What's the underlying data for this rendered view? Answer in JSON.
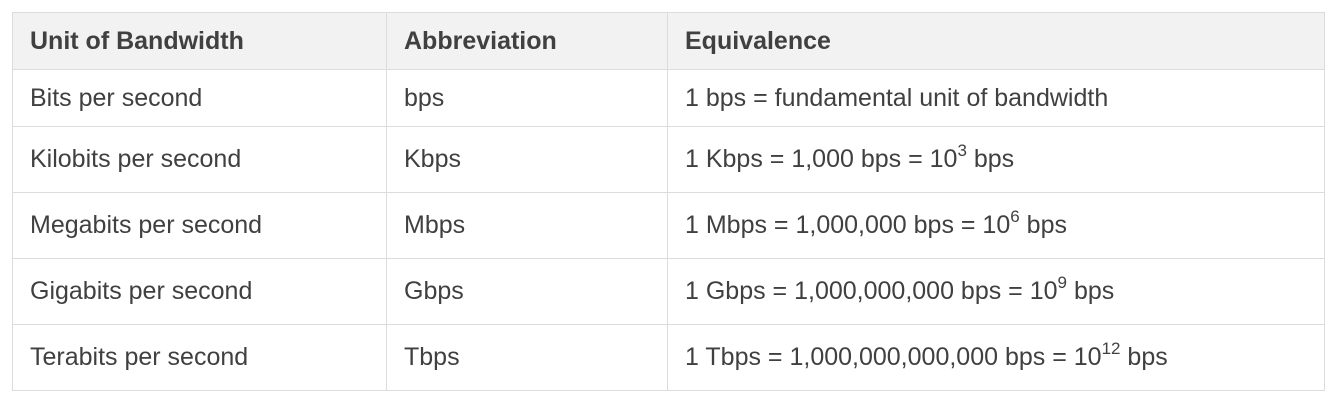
{
  "table": {
    "headers": [
      "Unit of Bandwidth",
      "Abbreviation",
      "Equivalence"
    ],
    "rows": [
      {
        "unit": "Bits per second",
        "abbr": "bps",
        "eq_main": "1 bps = fundamental unit of bandwidth",
        "eq_exp": "",
        "eq_tail": ""
      },
      {
        "unit": "Kilobits per second",
        "abbr": "Kbps",
        "eq_main": "1 Kbps = 1,000 bps = 10",
        "eq_exp": "3",
        "eq_tail": " bps"
      },
      {
        "unit": "Megabits per second",
        "abbr": "Mbps",
        "eq_main": "1 Mbps = 1,000,000 bps = 10",
        "eq_exp": "6",
        "eq_tail": " bps"
      },
      {
        "unit": "Gigabits per second",
        "abbr": "Gbps",
        "eq_main": "1 Gbps = 1,000,000,000 bps = 10",
        "eq_exp": "9",
        "eq_tail": " bps"
      },
      {
        "unit": "Terabits per second",
        "abbr": "Tbps",
        "eq_main": "1 Tbps = 1,000,000,000,000 bps = 10",
        "eq_exp": "12",
        "eq_tail": " bps"
      }
    ]
  }
}
